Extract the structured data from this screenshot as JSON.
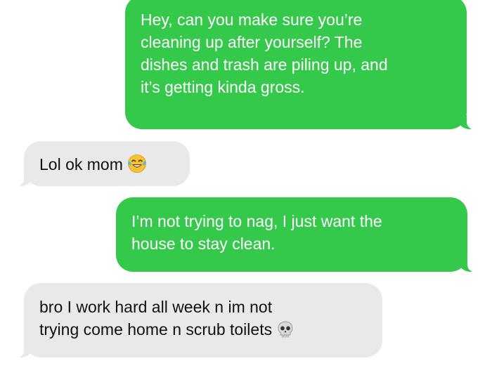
{
  "conversation": {
    "messages": [
      {
        "direction": "sent",
        "lines": [
          "Hey, can you make sure you’re",
          "cleaning up after yourself? The",
          "dishes and trash are piling up, and",
          "it’s getting kinda gross."
        ]
      },
      {
        "direction": "received",
        "lines": [
          "Lol ok mom"
        ],
        "emoji": "face-with-tears-of-joy-icon"
      },
      {
        "direction": "sent",
        "lines": [
          "I’m not trying to nag, I just want the",
          "house to stay clean."
        ]
      },
      {
        "direction": "received",
        "lines": [
          "bro I work hard all week n im not",
          "trying come home n scrub toilets"
        ],
        "emoji": "skull-icon"
      }
    ]
  },
  "colors": {
    "sent_bubble": "#35c94b",
    "received_bubble": "#e9e9eb",
    "sent_text": "#ffffff",
    "received_text": "#111111",
    "background": "#ffffff"
  }
}
